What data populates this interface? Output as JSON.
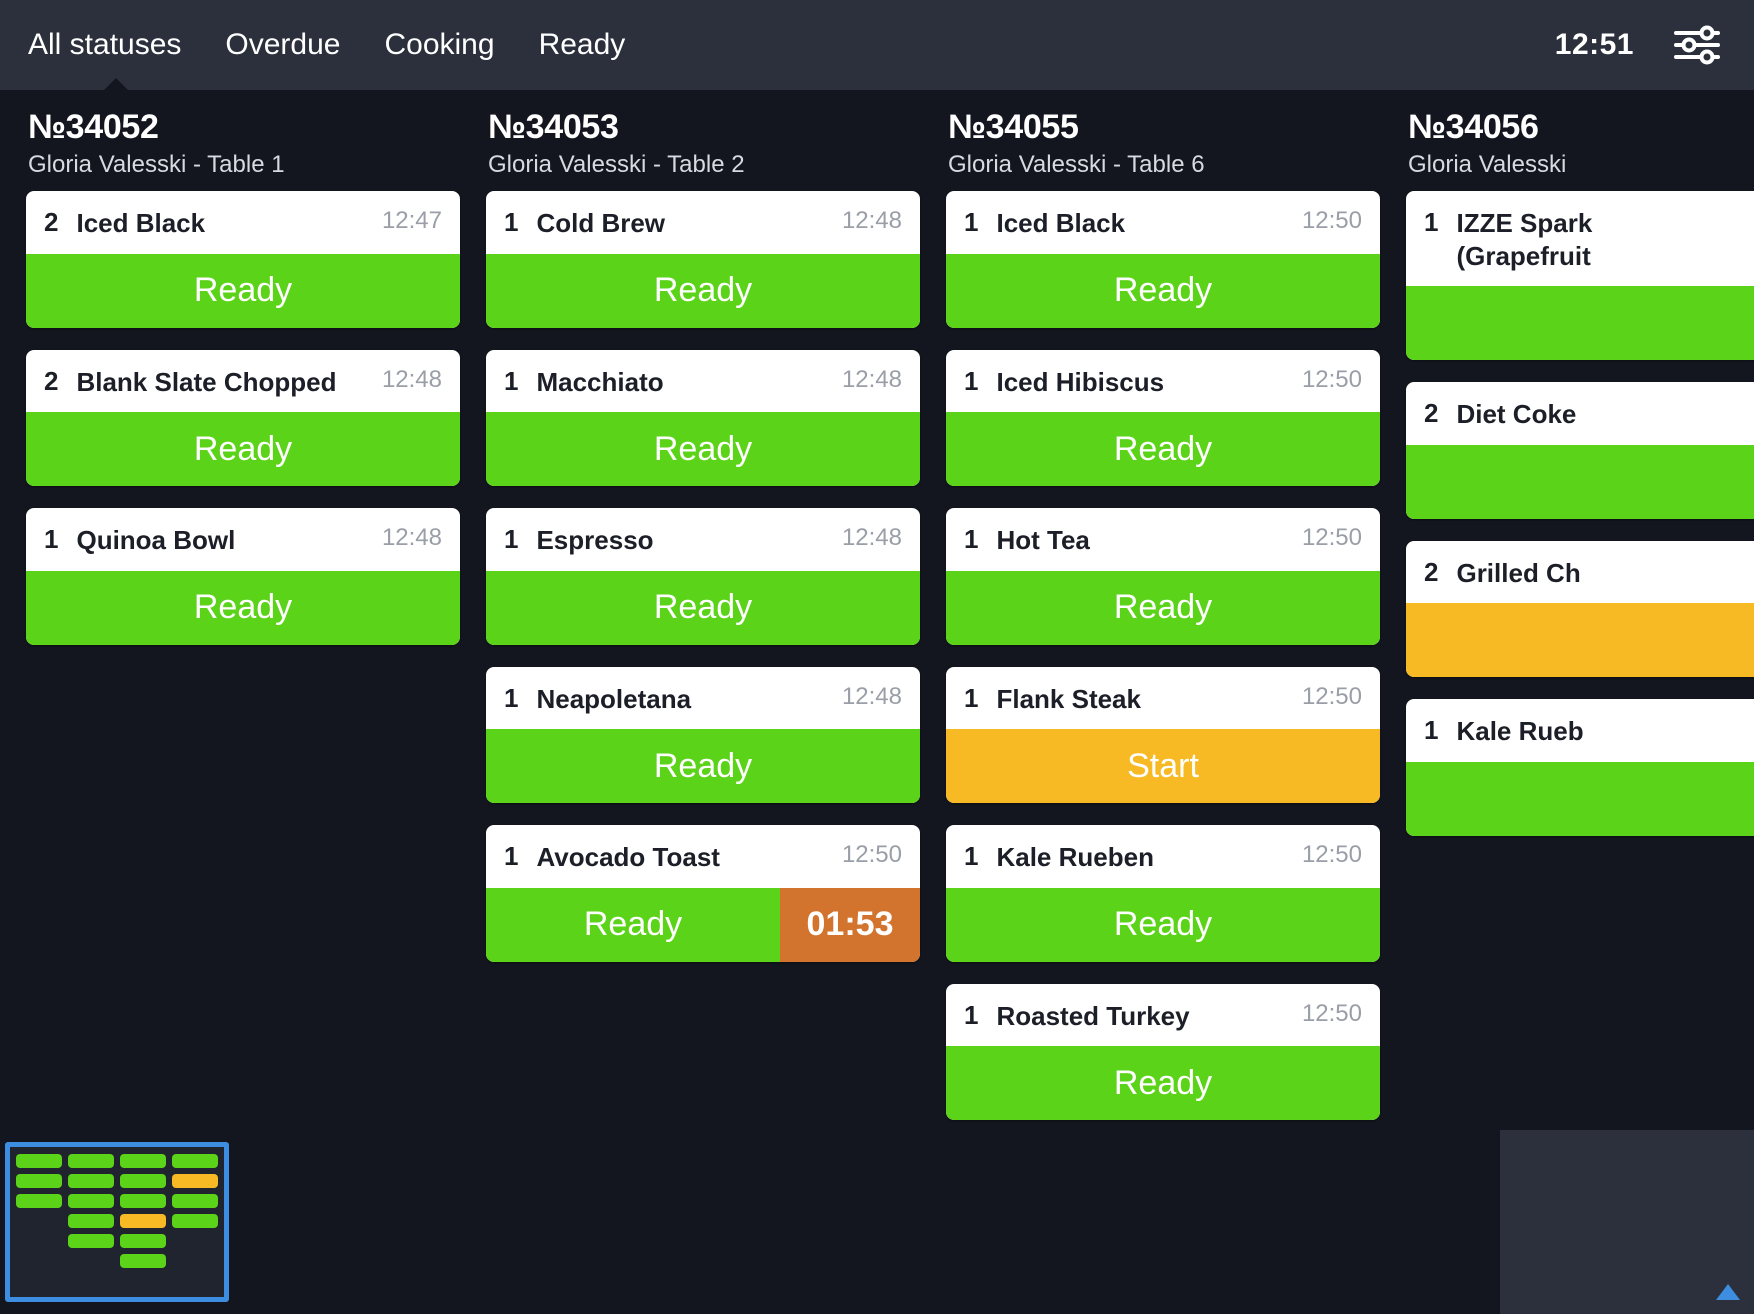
{
  "header": {
    "tabs": [
      {
        "label": "All statuses",
        "active": true
      },
      {
        "label": "Overdue",
        "active": false
      },
      {
        "label": "Cooking",
        "active": false
      },
      {
        "label": "Ready",
        "active": false
      }
    ],
    "clock": "12:51",
    "settings_icon": "sliders-icon"
  },
  "colors": {
    "background": "#13161f",
    "header_bg": "#2b303c",
    "ready_green": "#5bd318",
    "start_amber": "#f7b924",
    "timer_orange": "#d2732e",
    "viewport_blue": "#3d8ee0",
    "card_white": "#ffffff"
  },
  "orders": [
    {
      "number": "№34052",
      "customer": "Gloria Valesski - Table 1",
      "items": [
        {
          "qty": "2",
          "name": "Iced Black",
          "time": "12:47",
          "action": "Ready",
          "action_type": "ready"
        },
        {
          "qty": "2",
          "name": "Blank Slate Chopped",
          "time": "12:48",
          "action": "Ready",
          "action_type": "ready"
        },
        {
          "qty": "1",
          "name": "Quinoa Bowl",
          "time": "12:48",
          "action": "Ready",
          "action_type": "ready"
        }
      ]
    },
    {
      "number": "№34053",
      "customer": "Gloria Valesski - Table 2",
      "items": [
        {
          "qty": "1",
          "name": "Cold Brew",
          "time": "12:48",
          "action": "Ready",
          "action_type": "ready"
        },
        {
          "qty": "1",
          "name": "Macchiato",
          "time": "12:48",
          "action": "Ready",
          "action_type": "ready"
        },
        {
          "qty": "1",
          "name": "Espresso",
          "time": "12:48",
          "action": "Ready",
          "action_type": "ready"
        },
        {
          "qty": "1",
          "name": "Neapoletana",
          "time": "12:48",
          "action": "Ready",
          "action_type": "ready"
        },
        {
          "qty": "1",
          "name": "Avocado Toast",
          "time": "12:50",
          "action": "Ready",
          "action_type": "ready",
          "timer": "01:53"
        }
      ]
    },
    {
      "number": "№34055",
      "customer": "Gloria Valesski - Table 6",
      "items": [
        {
          "qty": "1",
          "name": "Iced Black",
          "time": "12:50",
          "action": "Ready",
          "action_type": "ready"
        },
        {
          "qty": "1",
          "name": "Iced Hibiscus",
          "time": "12:50",
          "action": "Ready",
          "action_type": "ready"
        },
        {
          "qty": "1",
          "name": "Hot Tea",
          "time": "12:50",
          "action": "Ready",
          "action_type": "ready"
        },
        {
          "qty": "1",
          "name": "Flank Steak",
          "time": "12:50",
          "action": "Start",
          "action_type": "start"
        },
        {
          "qty": "1",
          "name": "Kale Rueben",
          "time": "12:50",
          "action": "Ready",
          "action_type": "ready"
        },
        {
          "qty": "1",
          "name": "Roasted Turkey",
          "time": "12:50",
          "action": "Ready",
          "action_type": "ready"
        }
      ]
    },
    {
      "number": "№34056",
      "customer": "Gloria Valesski",
      "items": [
        {
          "qty": "1",
          "name": "IZZE Spark\n(Grapefruit",
          "time": "",
          "action": "",
          "action_type": "ready"
        },
        {
          "qty": "2",
          "name": "Diet Coke",
          "time": "",
          "action": "",
          "action_type": "ready"
        },
        {
          "qty": "2",
          "name": "Grilled Ch",
          "time": "",
          "action": "",
          "action_type": "start"
        },
        {
          "qty": "1",
          "name": "Kale Rueb",
          "time": "",
          "action": "",
          "action_type": "ready"
        }
      ]
    }
  ],
  "minimap": {
    "columns": [
      {
        "bars": [
          "green",
          "green",
          "green"
        ]
      },
      {
        "bars": [
          "green",
          "green",
          "green",
          "green",
          "green"
        ]
      },
      {
        "bars": [
          "green",
          "green",
          "green",
          "yellow",
          "green",
          "green"
        ]
      },
      {
        "bars": [
          "green",
          "green",
          "yellow",
          "green"
        ]
      },
      {
        "bars": [
          "green",
          "green"
        ]
      }
    ]
  }
}
